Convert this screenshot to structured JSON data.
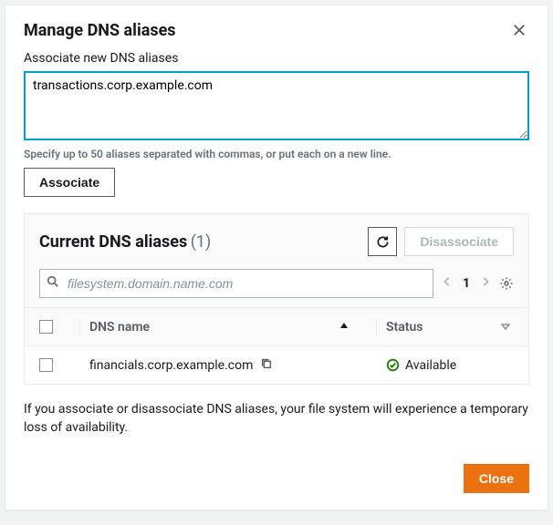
{
  "dialog": {
    "title": "Manage DNS aliases",
    "close_button": "Close"
  },
  "associate": {
    "label": "Associate new DNS aliases",
    "value": "transactions.corp.example.com",
    "hint": "Specify up to 50 aliases separated with commas, or put each on a new line.",
    "button": "Associate"
  },
  "panel": {
    "title": "Current DNS aliases",
    "count_display": "(1)",
    "disassociate": "Disassociate",
    "search_placeholder": "filesystem.domain.name.com",
    "page": "1"
  },
  "columns": {
    "name": "DNS name",
    "status": "Status"
  },
  "rows": [
    {
      "name": "financials.corp.example.com",
      "status": "Available"
    }
  ],
  "warning": "If you associate or disassociate DNS aliases, your file system will experience a temporary loss of availability."
}
